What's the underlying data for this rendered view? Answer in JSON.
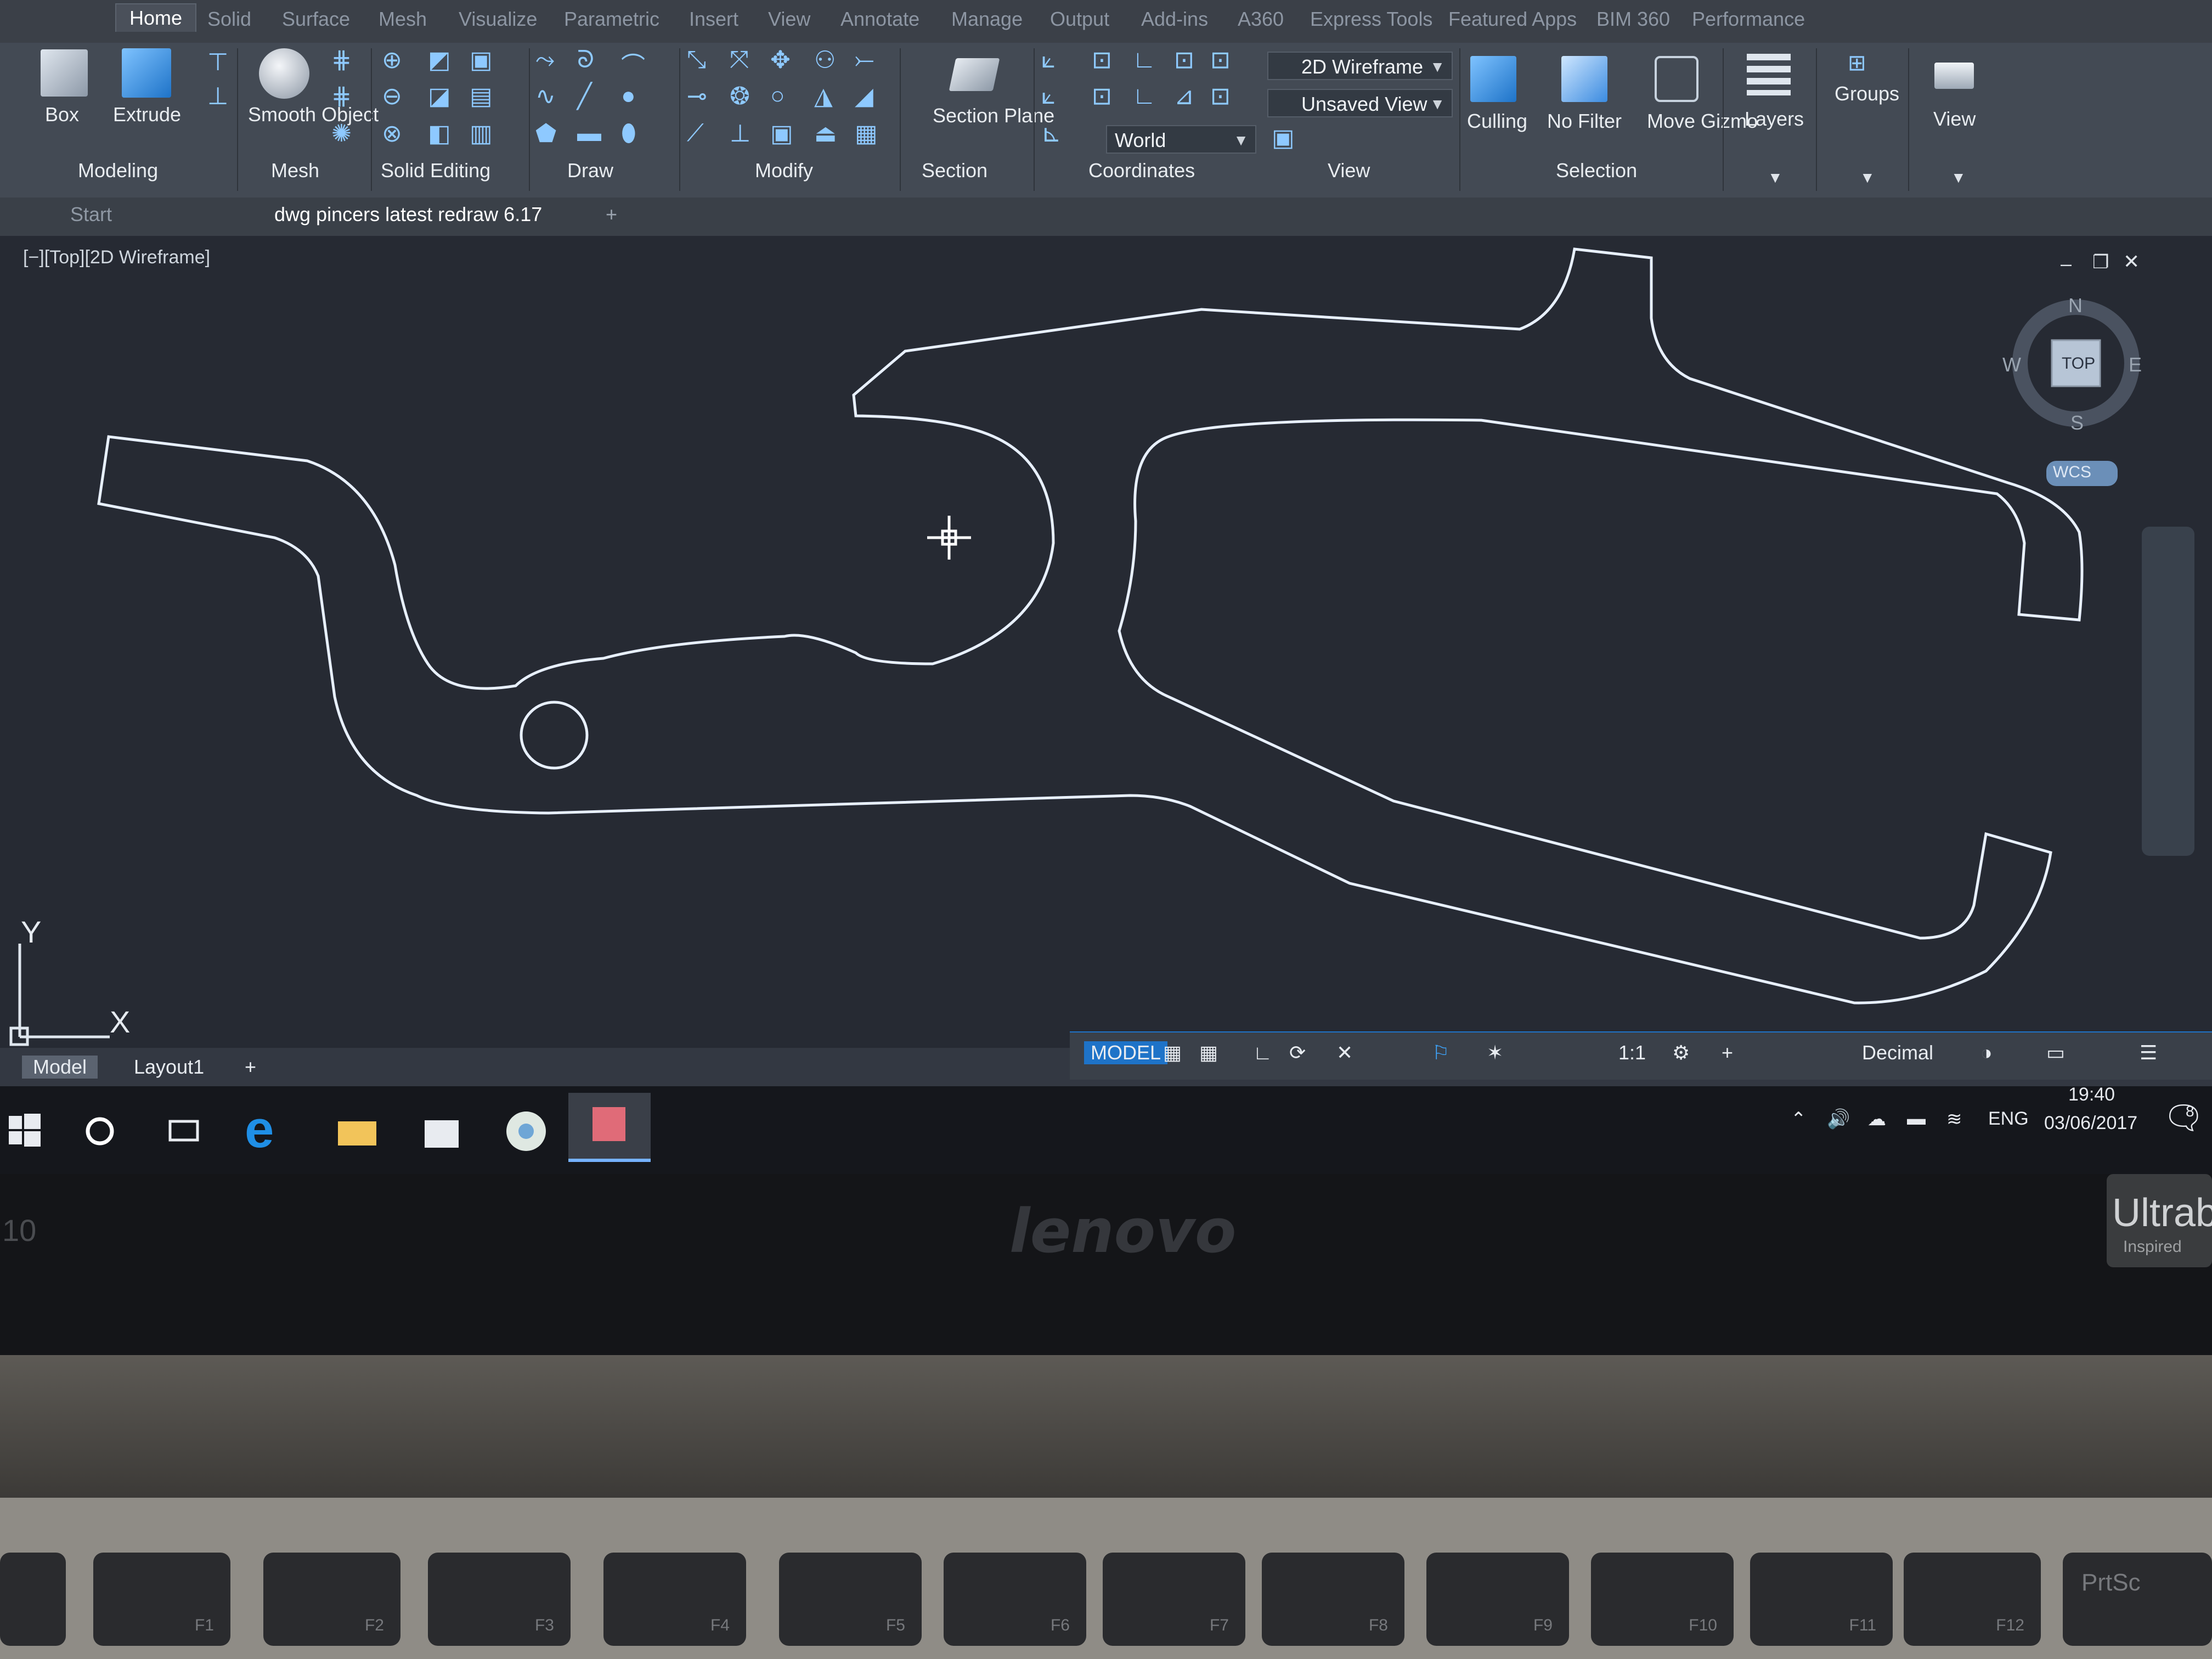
{
  "ribbon_tabs": [
    "Home",
    "Solid",
    "Surface",
    "Mesh",
    "Visualize",
    "Parametric",
    "Insert",
    "View",
    "Annotate",
    "Manage",
    "Output",
    "Add-ins",
    "A360",
    "Express Tools",
    "Featured Apps",
    "BIM 360",
    "Performance"
  ],
  "ribbon": {
    "box": "Box",
    "extrude": "Extrude",
    "smooth_object": "Smooth Object",
    "section_plane": "Section Plane",
    "visual_style": "2D Wireframe",
    "saved_view": "Unsaved View",
    "ucs": "World",
    "culling": "Culling",
    "no_filter": "No Filter",
    "move_gizmo": "Move Gizmo",
    "layers": "Layers",
    "groups": "Groups",
    "view": "View",
    "panels": [
      "Modeling",
      "Mesh",
      "Solid Editing",
      "Draw",
      "Modify",
      "Section",
      "Coordinates",
      "View",
      "Selection"
    ]
  },
  "file_tabs": {
    "start": "Start",
    "active": "dwg pincers latest redraw 6.17",
    "new_tab": "+"
  },
  "viewport": {
    "label": "[−][Top][2D Wireframe]",
    "viewcube": {
      "n": "N",
      "s": "S",
      "e": "E",
      "w": "W",
      "face": "TOP",
      "wcs": "WCS"
    },
    "ucs_x": "X",
    "ucs_y": "Y"
  },
  "layout_tabs": {
    "model": "Model",
    "layout1": "Layout1",
    "add": "+"
  },
  "status_bar": {
    "mode": "MODEL",
    "scale": "1:1",
    "units": "Decimal"
  },
  "taskbar": {
    "lang": "ENG",
    "time": "19:40",
    "date": "03/06/2017",
    "notifications": "8"
  },
  "laptop": {
    "brand": "lenovo",
    "sticker": "Ultrab",
    "sticker_sub": "Inspired",
    "edge_number": "10"
  },
  "keys": [
    "F1",
    "F2",
    "F3",
    "F4",
    "F5",
    "F6",
    "F7",
    "F8",
    "F9",
    "F10",
    "F11",
    "F12",
    "PrtSc"
  ],
  "colors": {
    "accent": "#1e73c8",
    "drawing_lines": "#e8f0ff",
    "viewport_bg": "#262a33"
  }
}
